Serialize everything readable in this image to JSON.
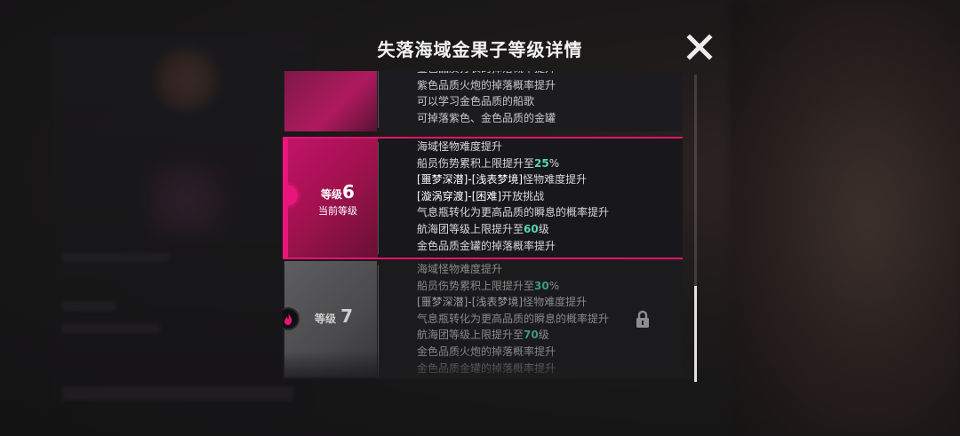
{
  "title": "失落海域金果子等级详情",
  "colors": {
    "accent": "#e8157a",
    "highlight": "#56d6b5"
  },
  "levels": [
    {
      "state": "past",
      "lines": [
        [
          {
            "t": "金色品质打表的掉落概率提升"
          }
        ],
        [
          {
            "t": "紫色品质火炮的掉落概率提升"
          }
        ],
        [
          {
            "t": "可以学习金色品质的船歌"
          }
        ],
        [
          {
            "t": "可掉落紫色、金色品质的金罐"
          }
        ]
      ]
    },
    {
      "state": "current",
      "level_word": "等级",
      "level_number": "6",
      "current_label": "当前等级",
      "lines": [
        [
          {
            "t": "海域怪物难度提升"
          }
        ],
        [
          {
            "t": "船员伤势累积上限提升至"
          },
          {
            "t": "25",
            "c": "hl"
          },
          {
            "t": "%"
          }
        ],
        [
          {
            "t": "[噩梦深潜]-[浅表梦境]",
            "c": "b"
          },
          {
            "t": "怪物难度提升"
          }
        ],
        [
          {
            "t": "[漩涡穿渡]-[困难]",
            "c": "b"
          },
          {
            "t": "开放挑战"
          }
        ],
        [
          {
            "t": "气息瓶转化为更高品质的瞬息的概率提升"
          }
        ],
        [
          {
            "t": "航海团等级上限提升至"
          },
          {
            "t": "60",
            "c": "hl"
          },
          {
            "t": "级"
          }
        ],
        [
          {
            "t": "金色品质金罐的掉落概率提升"
          }
        ]
      ]
    },
    {
      "state": "locked",
      "level_word": "等级",
      "level_number": "7",
      "lines": [
        [
          {
            "t": "海域怪物难度提升"
          }
        ],
        [
          {
            "t": "船员伤势累积上限提升至"
          },
          {
            "t": "30",
            "c": "hl"
          },
          {
            "t": "%"
          }
        ],
        [
          {
            "t": "[噩梦深潜]-[浅表梦境]",
            "c": "b"
          },
          {
            "t": "怪物难度提升"
          }
        ],
        [
          {
            "t": "气息瓶转化为更高品质的瞬息的概率提升"
          }
        ],
        [
          {
            "t": "航海团等级上限提升至"
          },
          {
            "t": "70",
            "c": "hl"
          },
          {
            "t": "级"
          }
        ],
        [
          {
            "t": "金色品质火炮的掉落概率提升"
          }
        ],
        [
          {
            "t": "金色品质金罐的掉落概率提升"
          }
        ]
      ]
    }
  ],
  "icons": {
    "close": "close-icon",
    "lock": "lock-icon",
    "fire": "flame-icon"
  }
}
